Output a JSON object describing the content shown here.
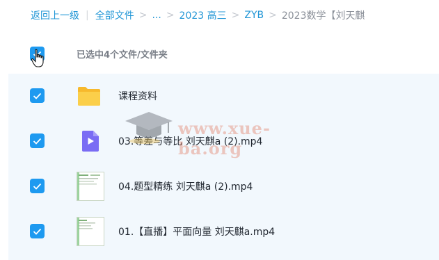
{
  "breadcrumb": {
    "back_label": "返回上一级",
    "items": [
      {
        "label": "全部文件"
      },
      {
        "label": "..."
      },
      {
        "label": "2023 高三"
      },
      {
        "label": "ZYB"
      }
    ],
    "current_label": "2023数学【刘天麒"
  },
  "selection": {
    "summary": "已选中4个文件/文件夹",
    "select_all_checked": true
  },
  "files": [
    {
      "name": "课程资料",
      "type": "folder",
      "checked": true,
      "icon": "folder-icon"
    },
    {
      "name": "03.等差与等比 刘天麒a (2).mp4",
      "type": "video",
      "checked": true,
      "icon": "video-file-icon"
    },
    {
      "name": "04.题型精练 刘天麒a (2).mp4",
      "type": "video",
      "checked": true,
      "icon": "video-thumbnail"
    },
    {
      "name": "01.【直播】平面向量 刘天麒a.mp4",
      "type": "video",
      "checked": true,
      "icon": "video-thumbnail"
    }
  ],
  "watermark": {
    "text": "www.xue-ba.org"
  },
  "colors": {
    "accent": "#1e9af0",
    "link": "#2196d6",
    "list_background": "#f2f8fd",
    "folder": "#f9c33c",
    "video_icon": "#7a6cf4"
  }
}
